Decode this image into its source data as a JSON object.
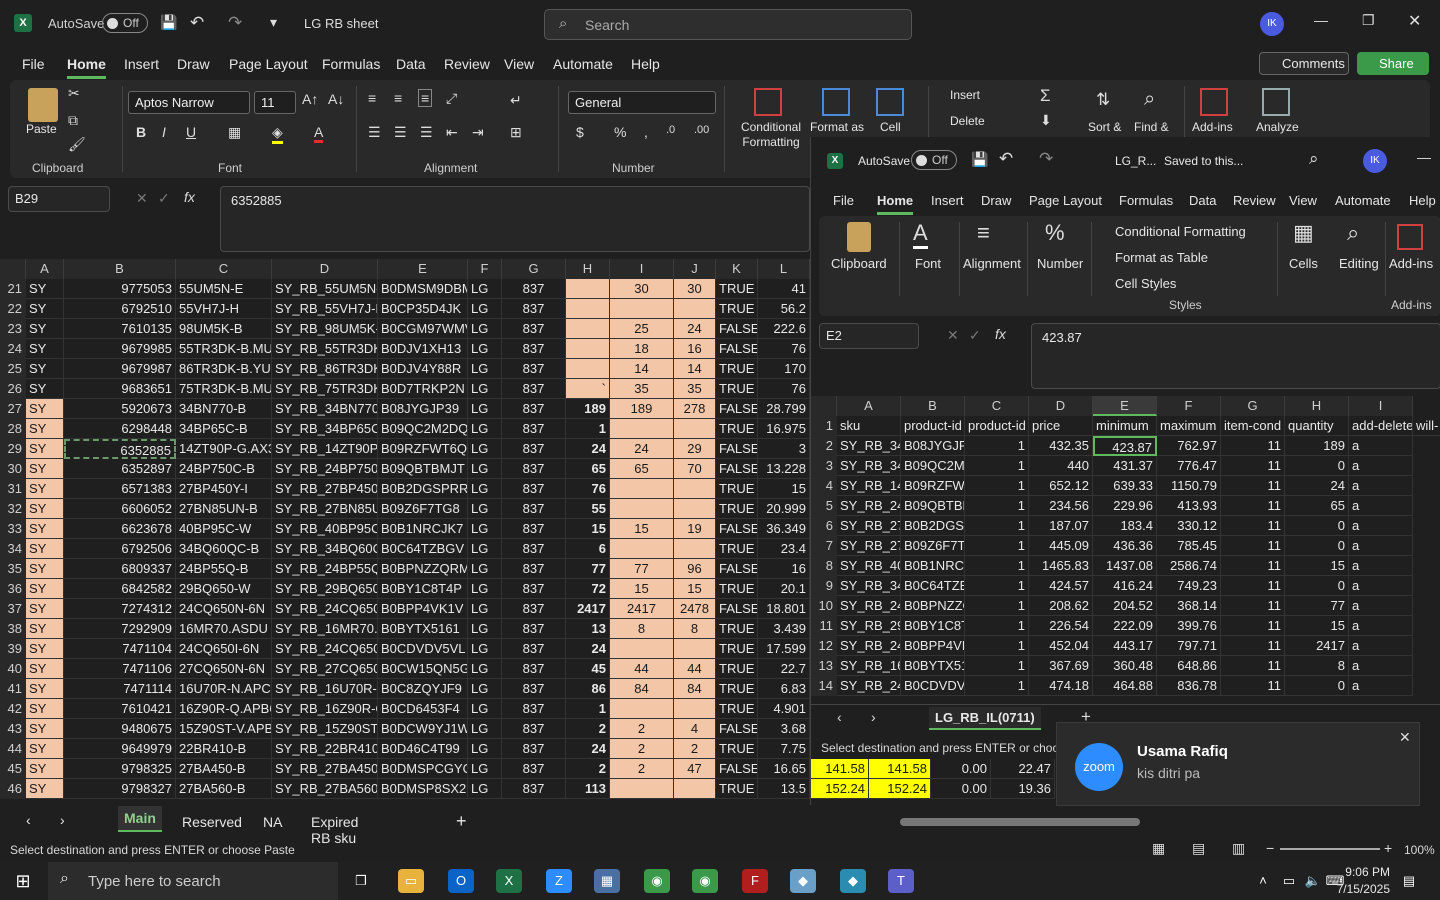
{
  "main": {
    "title": "LG RB sheet",
    "autosave_label": "AutoSave",
    "autosave_state": "Off",
    "search_placeholder": "Search",
    "avatar": "IK",
    "menu": [
      "File",
      "Home",
      "Insert",
      "Draw",
      "Page Layout",
      "Formulas",
      "Data",
      "Review",
      "View",
      "Automate",
      "Help"
    ],
    "comments": "Comments",
    "share": "Share",
    "ribbon": {
      "paste": "Paste",
      "clipboard": "Clipboard",
      "font_name": "Aptos Narrow",
      "font_size": "11",
      "font": "Font",
      "alignment": "Alignment",
      "number_format": "General",
      "number": "Number",
      "conditional_formatting": "Conditional Formatting",
      "format_as": "Format as",
      "cell": "Cell",
      "insert": "Insert",
      "delete": "Delete",
      "sort": "Sort &",
      "find": "Find &",
      "addins": "Add-ins",
      "analyze": "Analyze"
    },
    "name_box": "B29",
    "formula": "6352885",
    "columns": [
      "A",
      "B",
      "C",
      "D",
      "E",
      "F",
      "G",
      "H",
      "I",
      "J",
      "K",
      "L"
    ],
    "rows": [
      {
        "n": "21",
        "a": "SY",
        "b": "9775053",
        "c": "55UM5N-E",
        "d": "SY_RB_55UM5N-E",
        "e": "B0DMSM9DBM",
        "f": "LG",
        "g": "837",
        "h": "",
        "i": "30",
        "j": "30",
        "k": "TRUE",
        "l": "41"
      },
      {
        "n": "22",
        "a": "SY",
        "b": "6792510",
        "c": "55VH7J-H",
        "d": "SY_RB_55VH7J-H",
        "e": "B0CP35D4JK",
        "f": "LG",
        "g": "837",
        "h": "",
        "i": "",
        "j": "",
        "k": "TRUE",
        "l": "56.2"
      },
      {
        "n": "23",
        "a": "SY",
        "b": "7610135",
        "c": "98UM5K-B",
        "d": "SY_RB_98UM5K-B",
        "e": "B0CGM97WMV",
        "f": "LG",
        "g": "837",
        "h": "",
        "i": "25",
        "j": "24",
        "k": "FALSE",
        "l": "222.6"
      },
      {
        "n": "24",
        "a": "SY",
        "b": "9679985",
        "c": "55TR3DK-B.MUS",
        "d": "SY_RB_55TR3DK-B",
        "e": "B0DJV1XH13",
        "f": "LG",
        "g": "837",
        "h": "",
        "i": "18",
        "j": "16",
        "k": "FALSE",
        "l": "76"
      },
      {
        "n": "25",
        "a": "SY",
        "b": "9679987",
        "c": "86TR3DK-B.YUS",
        "d": "SY_RB_86TR3DK-B",
        "e": "B0DJV4Y88R",
        "f": "LG",
        "g": "837",
        "h": "",
        "i": "14",
        "j": "14",
        "k": "TRUE",
        "l": "170"
      },
      {
        "n": "26",
        "a": "SY",
        "b": "9683651",
        "c": "75TR3DK-B.MUS",
        "d": "SY_RB_75TR3DK-B",
        "e": "B0D7TRKP2N",
        "f": "LG",
        "g": "837",
        "h": "`",
        "i": "35",
        "j": "35",
        "k": "TRUE",
        "l": "76"
      },
      {
        "n": "27",
        "a": "SY",
        "b": "5920673",
        "c": "34BN770-B",
        "d": "SY_RB_34BN770-B",
        "e": "B08JYGJP39",
        "f": "LG",
        "g": "837",
        "h": "189",
        "i": "189",
        "j": "278",
        "k": "FALSE",
        "l": "28.799"
      },
      {
        "n": "28",
        "a": "SY",
        "b": "6298448",
        "c": "34BP65C-B",
        "d": "SY_RB_34BP65C-B",
        "e": "B09QC2M2DQ",
        "f": "LG",
        "g": "837",
        "h": "1",
        "i": "",
        "j": "",
        "k": "TRUE",
        "l": "16.975"
      },
      {
        "n": "29",
        "a": "SY",
        "b": "6352885",
        "c": "14ZT90P-G.AX3",
        "d": "SY_RB_14ZT90P-G",
        "e": "B09RZFWT6Q",
        "f": "LG",
        "g": "837",
        "h": "24",
        "i": "24",
        "j": "29",
        "k": "FALSE",
        "l": "3"
      },
      {
        "n": "30",
        "a": "SY",
        "b": "6352897",
        "c": "24BP750C-B",
        "d": "SY_RB_24BP750C",
        "e": "B09QBTBMJT",
        "f": "LG",
        "g": "837",
        "h": "65",
        "i": "65",
        "j": "70",
        "k": "FALSE",
        "l": "13.228"
      },
      {
        "n": "31",
        "a": "SY",
        "b": "6571383",
        "c": "27BP450Y-I",
        "d": "SY_RB_27BP450Y-",
        "e": "B0B2DGSPRR",
        "f": "LG",
        "g": "837",
        "h": "76",
        "i": "",
        "j": "",
        "k": "TRUE",
        "l": "15"
      },
      {
        "n": "32",
        "a": "SY",
        "b": "6606052",
        "c": "27BN85UN-B",
        "d": "SY_RB_27BN85UN",
        "e": "B09Z6F7TG8",
        "f": "LG",
        "g": "837",
        "h": "55",
        "i": "",
        "j": "",
        "k": "TRUE",
        "l": "20.999"
      },
      {
        "n": "33",
        "a": "SY",
        "b": "6623678",
        "c": "40BP95C-W",
        "d": "SY_RB_40BP95C-W",
        "e": "B0B1NRCJK7",
        "f": "LG",
        "g": "837",
        "h": "15",
        "i": "15",
        "j": "19",
        "k": "FALSE",
        "l": "36.349"
      },
      {
        "n": "34",
        "a": "SY",
        "b": "6792506",
        "c": "34BQ60QC-B",
        "d": "SY_RB_34BQ60QC",
        "e": "B0C64TZBGV",
        "f": "LG",
        "g": "837",
        "h": "6",
        "i": "",
        "j": "",
        "k": "TRUE",
        "l": "23.4"
      },
      {
        "n": "35",
        "a": "SY",
        "b": "6809337",
        "c": "24BP55Q-B",
        "d": "SY_RB_24BP55Q-",
        "e": "B0BPNZZQRM",
        "f": "LG",
        "g": "837",
        "h": "77",
        "i": "77",
        "j": "96",
        "k": "FALSE",
        "l": "16"
      },
      {
        "n": "36",
        "a": "SY",
        "b": "6842582",
        "c": "29BQ650-W",
        "d": "SY_RB_29BQ650-W",
        "e": "B0BY1C8T4P",
        "f": "LG",
        "g": "837",
        "h": "72",
        "i": "15",
        "j": "15",
        "k": "TRUE",
        "l": "20.1"
      },
      {
        "n": "37",
        "a": "SY",
        "b": "7274312",
        "c": "24CQ650N-6N",
        "d": "SY_RB_24CQ650N",
        "e": "B0BPP4VK1V",
        "f": "LG",
        "g": "837",
        "h": "2417",
        "i": "2417",
        "j": "2478",
        "k": "FALSE",
        "l": "18.801"
      },
      {
        "n": "38",
        "a": "SY",
        "b": "7292909",
        "c": "16MR70.ASDU",
        "d": "SY_RB_16MR70.AS",
        "e": "B0BYTX5161",
        "f": "LG",
        "g": "837",
        "h": "13",
        "i": "8",
        "j": "8",
        "k": "TRUE",
        "l": "3.439"
      },
      {
        "n": "39",
        "a": "SY",
        "b": "7471104",
        "c": "24CQ650I-6N",
        "d": "SY_RB_24CQ650I-",
        "e": "B0CDVDV5VL",
        "f": "LG",
        "g": "837",
        "h": "24",
        "i": "",
        "j": "",
        "k": "TRUE",
        "l": "17.599"
      },
      {
        "n": "40",
        "a": "SY",
        "b": "7471106",
        "c": "27CQ650N-6N",
        "d": "SY_RB_27CQ650N",
        "e": "B0CW15QN5G",
        "f": "LG",
        "g": "837",
        "h": "45",
        "i": "44",
        "j": "44",
        "k": "TRUE",
        "l": "22.7"
      },
      {
        "n": "41",
        "a": "SY",
        "b": "7471114",
        "c": "16U70R-N.APC5",
        "d": "SY_RB_16U70R-N",
        "e": "B0C8ZQYJF9",
        "f": "LG",
        "g": "837",
        "h": "86",
        "i": "84",
        "j": "84",
        "k": "TRUE",
        "l": "6.83"
      },
      {
        "n": "42",
        "a": "SY",
        "b": "7610421",
        "c": "16Z90R-Q.APB6",
        "d": "SY_RB_16Z90R-Q.",
        "e": "B0CD6453F4",
        "f": "LG",
        "g": "837",
        "h": "1",
        "i": "",
        "j": "",
        "k": "TRUE",
        "l": "4.901"
      },
      {
        "n": "43",
        "a": "SY",
        "b": "9480675",
        "c": "15Z90ST-V.APB6",
        "d": "SY_RB_15Z90ST-V",
        "e": "B0DCW9YJ1W",
        "f": "LG",
        "g": "837",
        "h": "2",
        "i": "2",
        "j": "4",
        "k": "FALSE",
        "l": "3.68"
      },
      {
        "n": "44",
        "a": "SY",
        "b": "9649979",
        "c": "22BR410-B",
        "d": "SY_RB_22BR410-B",
        "e": "B0D46C4T99",
        "f": "LG",
        "g": "837",
        "h": "24",
        "i": "2",
        "j": "2",
        "k": "TRUE",
        "l": "7.75"
      },
      {
        "n": "45",
        "a": "SY",
        "b": "9798325",
        "c": "27BA450-B",
        "d": "SY_RB_27BA450-B",
        "e": "B0DMSPCGYQ",
        "f": "LG",
        "g": "837",
        "h": "2",
        "i": "2",
        "j": "47",
        "k": "FALSE",
        "l": "16.65"
      },
      {
        "n": "46",
        "a": "SY",
        "b": "9798327",
        "c": "27BA560-B",
        "d": "SY_RB_27BA560-B",
        "e": "B0DMSP8SX2",
        "f": "LG",
        "g": "837",
        "h": "113",
        "i": "",
        "j": "",
        "k": "TRUE",
        "l": "13.5"
      }
    ],
    "sheet_tabs": [
      "Main",
      "Reserved",
      "NA",
      "Expired RB sku"
    ],
    "status_msg": "Select destination and press ENTER or choose Paste",
    "zoom": "100%"
  },
  "secondary": {
    "autosave_label": "AutoSave",
    "autosave_state": "Off",
    "title": "LG_R...",
    "saved": "Saved to this...",
    "avatar": "IK",
    "menu": [
      "File",
      "Home",
      "Insert",
      "Draw",
      "Page Layout",
      "Formulas",
      "Data",
      "Review",
      "View",
      "Automate",
      "Help"
    ],
    "ribbon": {
      "clipboard": "Clipboard",
      "font": "Font",
      "alignment": "Alignment",
      "number": "Number",
      "cond_fmt": "Conditional Formatting",
      "fmt_table": "Format as Table",
      "cell_styles": "Cell Styles",
      "styles": "Styles",
      "cells": "Cells",
      "editing": "Editing",
      "addins": "Add-ins",
      "addins_group": "Add-ins"
    },
    "name_box": "E2",
    "formula": "423.87",
    "columns": [
      "A",
      "B",
      "C",
      "D",
      "E",
      "F",
      "G",
      "H",
      "I"
    ],
    "header": [
      "sku",
      "product-id",
      "product-id",
      "price",
      "minimum",
      "maximum",
      "item-cond",
      "quantity",
      "add-delete",
      "will-"
    ],
    "rows": [
      {
        "n": "2",
        "a": "SY_RB_34B",
        "b": "B08JYGJP3",
        "c": "1",
        "d": "432.35",
        "e": "423.87",
        "f": "762.97",
        "g": "11",
        "h": "189",
        "i": "a"
      },
      {
        "n": "3",
        "a": "SY_RB_34B",
        "b": "B09QC2M2",
        "c": "1",
        "d": "440",
        "e": "431.37",
        "f": "776.47",
        "g": "11",
        "h": "0",
        "i": "a"
      },
      {
        "n": "4",
        "a": "SY_RB_14Z",
        "b": "B09RZFWT",
        "c": "1",
        "d": "652.12",
        "e": "639.33",
        "f": "1150.79",
        "g": "11",
        "h": "24",
        "i": "a"
      },
      {
        "n": "5",
        "a": "SY_RB_24B",
        "b": "B09QBTBN",
        "c": "1",
        "d": "234.56",
        "e": "229.96",
        "f": "413.93",
        "g": "11",
        "h": "65",
        "i": "a"
      },
      {
        "n": "6",
        "a": "SY_RB_27B",
        "b": "B0B2DGSP",
        "c": "1",
        "d": "187.07",
        "e": "183.4",
        "f": "330.12",
        "g": "11",
        "h": "0",
        "i": "a"
      },
      {
        "n": "7",
        "a": "SY_RB_27B",
        "b": "B09Z6F7T",
        "c": "1",
        "d": "445.09",
        "e": "436.36",
        "f": "785.45",
        "g": "11",
        "h": "0",
        "i": "a"
      },
      {
        "n": "8",
        "a": "SY_RB_40B",
        "b": "B0B1NRCJ",
        "c": "1",
        "d": "1465.83",
        "e": "1437.08",
        "f": "2586.74",
        "g": "11",
        "h": "15",
        "i": "a"
      },
      {
        "n": "9",
        "a": "SY_RB_34B",
        "b": "B0C64TZB",
        "c": "1",
        "d": "424.57",
        "e": "416.24",
        "f": "749.23",
        "g": "11",
        "h": "0",
        "i": "a"
      },
      {
        "n": "10",
        "a": "SY_RB_24B",
        "b": "B0BPNZZC",
        "c": "1",
        "d": "208.62",
        "e": "204.52",
        "f": "368.14",
        "g": "11",
        "h": "77",
        "i": "a"
      },
      {
        "n": "11",
        "a": "SY_RB_29B",
        "b": "B0BY1C8T",
        "c": "1",
        "d": "226.54",
        "e": "222.09",
        "f": "399.76",
        "g": "11",
        "h": "15",
        "i": "a"
      },
      {
        "n": "12",
        "a": "SY_RB_24C",
        "b": "B0BPP4VK",
        "c": "1",
        "d": "452.04",
        "e": "443.17",
        "f": "797.71",
        "g": "11",
        "h": "2417",
        "i": "a"
      },
      {
        "n": "13",
        "a": "SY_RB_16N",
        "b": "B0BYTX51",
        "c": "1",
        "d": "367.69",
        "e": "360.48",
        "f": "648.86",
        "g": "11",
        "h": "8",
        "i": "a"
      },
      {
        "n": "14",
        "a": "SY_RB_24C",
        "b": "B0CDVDV5",
        "c": "1",
        "d": "474.18",
        "e": "464.88",
        "f": "836.78",
        "g": "11",
        "h": "0",
        "i": "a"
      }
    ],
    "sheet_tab": "LG_RB_IL(0711)",
    "status_msg": "Select destination and press ENTER or choose",
    "yellow_row": [
      {
        "v1": "141.58",
        "v2": "141.58",
        "v3": "0.00",
        "v4": "22.47"
      },
      {
        "v1": "152.24",
        "v2": "152.24",
        "v3": "0.00",
        "v4": "19.36"
      }
    ]
  },
  "notification": {
    "app": "zoom",
    "name": "Usama Rafiq",
    "message": "kis ditri pa"
  },
  "taskbar": {
    "search_placeholder": "Type here to search",
    "time": "9:06 PM",
    "date": "7/15/2025"
  }
}
